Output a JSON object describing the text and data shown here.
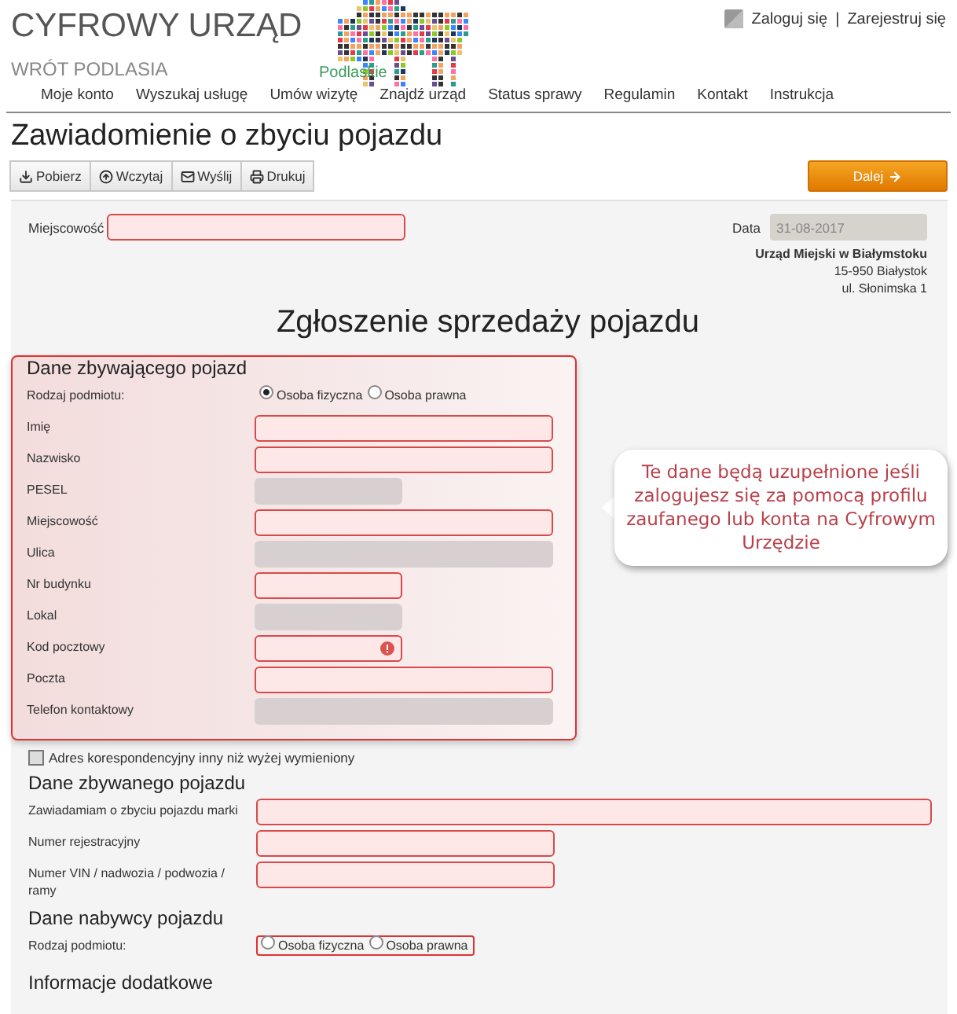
{
  "header": {
    "title": "CYFROWY URZĄD",
    "subtitle": "WRÓT PODLASIA",
    "logo_text": "Podlaskie",
    "auth_links": [
      "Zaloguj się",
      "Zarejestruj się"
    ],
    "separator": "|"
  },
  "nav": [
    "Moje konto",
    "Wyszukaj usługę",
    "Umów wizytę",
    "Znajdź urząd",
    "Status sprawy",
    "Regulamin",
    "Kontakt",
    "Instrukcja"
  ],
  "page_title": "Zawiadomienie o zbyciu pojazdu",
  "toolbar": {
    "buttons": [
      {
        "label": "Pobierz",
        "kind": "download"
      },
      {
        "label": "Wczytaj",
        "kind": "upload"
      },
      {
        "label": "Wyślij",
        "kind": "mail"
      },
      {
        "label": "Drukuj",
        "kind": "print"
      }
    ],
    "next": "Dalej"
  },
  "form": {
    "place": {
      "label": "Miejscowość"
    },
    "date": {
      "label": "Data",
      "value": "31-08-2017"
    },
    "office": [
      "Urząd Miejski w Białymstoku",
      "15-950 Białystok",
      "ul. Słonimska 1"
    ],
    "heading": "Zgłoszenie sprzedaży pojazdu",
    "seller": {
      "title": "Dane zbywającego pojazd",
      "fields": [
        {
          "kind": "radio",
          "label": "Rodzaj podmiotu:",
          "invalid": false,
          "options": [
            {
              "label": "Osoba fizyczna",
              "selected": true
            },
            {
              "label": "Osoba prawna",
              "selected": false
            }
          ]
        },
        {
          "kind": "input",
          "label": "Imię",
          "disabled": false
        },
        {
          "kind": "input",
          "label": "Nazwisko",
          "disabled": false
        },
        {
          "kind": "short-input",
          "label": "PESEL",
          "disabled": true
        },
        {
          "kind": "input",
          "label": "Miejscowość",
          "disabled": false
        },
        {
          "kind": "input",
          "label": "Ulica",
          "disabled": true
        },
        {
          "kind": "short-input",
          "label": "Nr budynku",
          "disabled": false
        },
        {
          "kind": "short-input",
          "label": "Lokal",
          "disabled": true
        },
        {
          "kind": "short-input",
          "label": "Kod pocztowy",
          "disabled": false,
          "error": true
        },
        {
          "kind": "input",
          "label": "Poczta",
          "disabled": false
        },
        {
          "kind": "input",
          "label": "Telefon kontaktowy",
          "disabled": true
        }
      ]
    },
    "callout": "Te dane będą uzupełnione jeśli zalogujesz się za pomocą profilu zaufanego lub konta na Cyfrowym Urzędzie",
    "checkbox": {
      "label": "Adres korespondencyjny inny niż wyżej wymieniony",
      "checked": false
    },
    "vehicle": {
      "title": "Dane zbywanego pojazdu",
      "fields": [
        {
          "kind": "wide-input",
          "label": "Zawiadamiam o zbyciu pojazdu marki",
          "disabled": false
        },
        {
          "kind": "input",
          "label": "Numer rejestracyjny",
          "disabled": false
        },
        {
          "kind": "input",
          "label": "Numer VIN / nadwozia / podwozia / ramy",
          "disabled": false
        }
      ]
    },
    "buyer": {
      "title": "Dane nabywcy pojazdu",
      "fields": [
        {
          "kind": "radio",
          "label": "Rodzaj podmiotu:",
          "invalid": true,
          "options": [
            {
              "label": "Osoba fizyczna",
              "selected": false
            },
            {
              "label": "Osoba prawna",
              "selected": false
            }
          ]
        }
      ]
    },
    "additional": {
      "title": "Informacje dodatkowe"
    }
  }
}
